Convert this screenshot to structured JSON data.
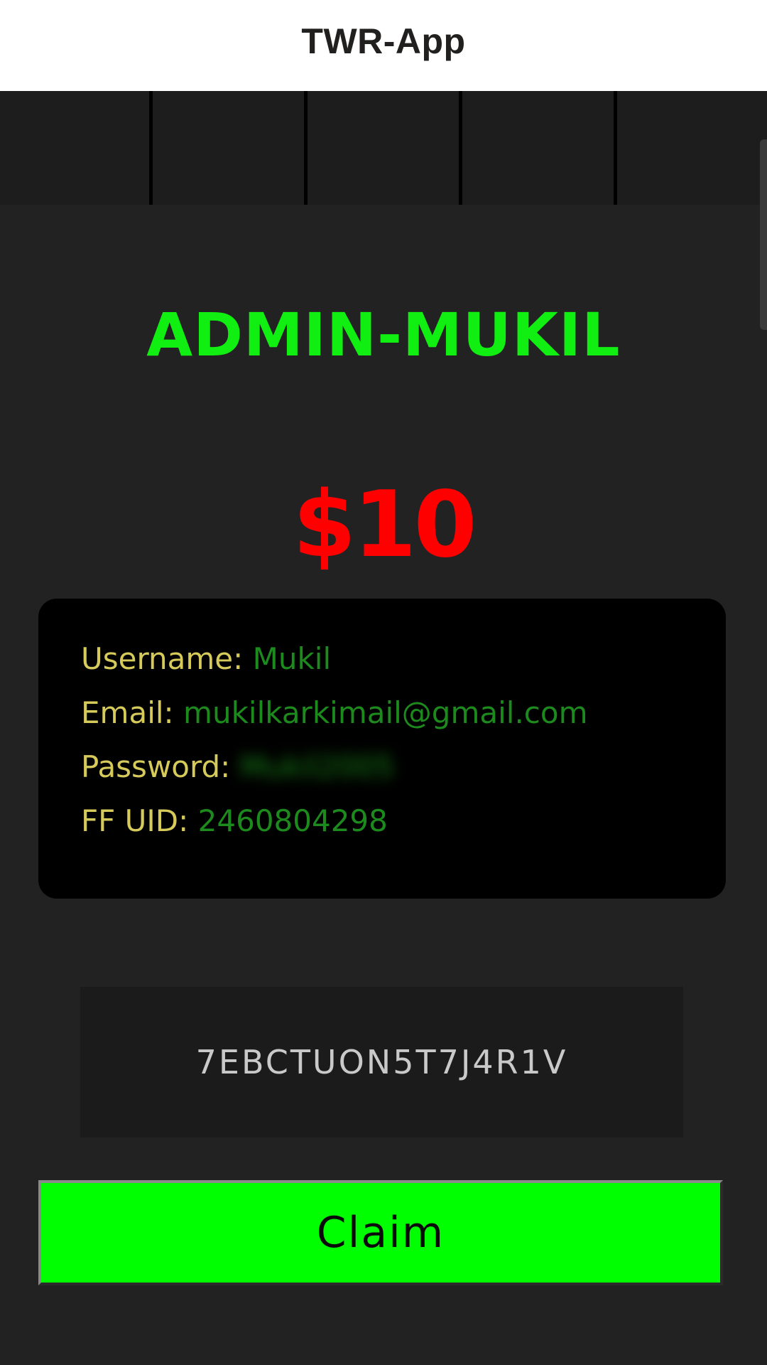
{
  "app": {
    "title": "TWR-App"
  },
  "tabs": {
    "count": 5
  },
  "profile": {
    "admin_name": "ADMIN-MUKIL",
    "price": "$10"
  },
  "account": {
    "username_label": "Username:",
    "username_value": "Mukil",
    "email_label": "Email:",
    "email_value": "mukilkarkimail@gmail.com",
    "password_label": "Password:",
    "password_value": "Mukil2005",
    "ffuid_label": "FF UID:",
    "ffuid_value": "2460804298"
  },
  "redeem": {
    "code": "7EBCTUON5T7J4R1V",
    "claim_label": "Claim"
  },
  "colors": {
    "accent_green": "#11ee11",
    "price_red": "#ff0000",
    "label_yellow": "#d6cb5a",
    "value_green": "#1c8a1c",
    "button_green": "#00ff00",
    "background": "#222222"
  }
}
